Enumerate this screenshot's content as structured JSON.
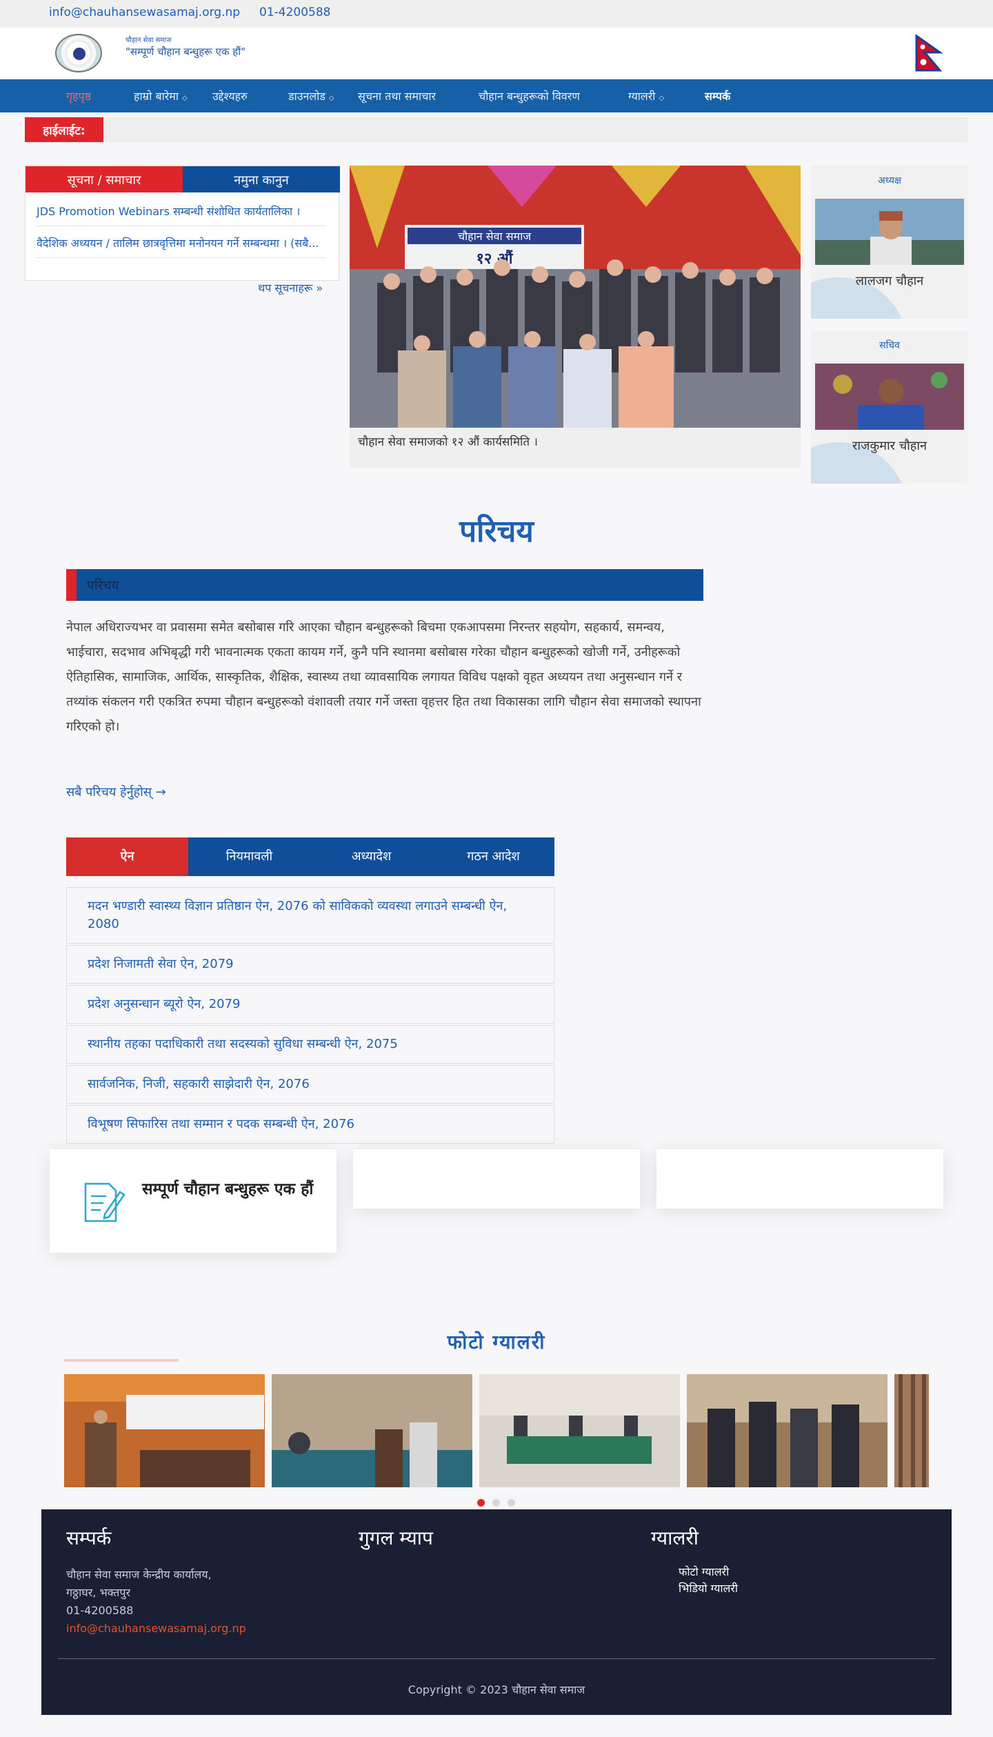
{
  "topbar": {
    "email": "info@chauhansewasamaj.org.np",
    "phone": "01-4200588"
  },
  "header": {
    "org_small": "चौहान सेवा समाज",
    "slogan": "\"सम्पूर्ण चौहान बन्धुहरू एक हौं\""
  },
  "nav": {
    "items": [
      {
        "label": "गृहपृष्ठ",
        "caret": false
      },
      {
        "label": "हाम्रो बारेमा",
        "caret": true
      },
      {
        "label": "उद्देश्यहरु",
        "caret": false
      },
      {
        "label": "डाउनलोड",
        "caret": true
      },
      {
        "label": "सूचना तथा समाचार",
        "caret": false
      },
      {
        "label": "चौहान बन्धुहरूको विवरण",
        "caret": false
      },
      {
        "label": "ग्यालरी",
        "caret": true
      },
      {
        "label": "सम्पर्क",
        "caret": false
      }
    ]
  },
  "highlight": {
    "label": "हाईलाईट:"
  },
  "news": {
    "tabs": [
      "सूचना / समाचार",
      "नमुना कानुन"
    ],
    "items": [
      "JDS Promotion Webinars सम्बन्धी संशोधित कार्यतालिका ।",
      "वैदेशिक अध्ययन / तालिम छात्रवृत्तिमा मनोनयन गर्ने सम्बन्धमा । (सबै..."
    ],
    "more": "थप सूचनाहरू »"
  },
  "hero": {
    "banner_org": "चौहान सेवा समाज",
    "banner_sub": "१२ औं",
    "caption": "चौहान सेवा समाजको १२ औं कार्यसमिति ।"
  },
  "profiles": [
    {
      "role": "अध्यक्ष",
      "name": "लालजग चौहान"
    },
    {
      "role": "सचिव",
      "name": "राजकुमार चौहान"
    }
  ],
  "intro": {
    "title": "परिचय",
    "bar_label": "परिचय",
    "text": "नेपाल अधिराज्यभर वा प्रवासमा समेत बसोबास गरि आएका चौहान बन्धुहरूको बिचमा एकआपसमा निरन्तर सहयोग, सहकार्य, समन्वय, भाईचारा, सदभाव अभिबृद्धी गरी भावनात्मक एकता कायम गर्ने, कुनै पनि स्थानमा बसोबास गरेका चौहान बन्धुहरूको खोजी गर्ने, उनीहरूको ऐतिहासिक, सामाजिक, आर्थिक, सास्कृतिक, शैक्षिक, स्वास्थ्य तथा व्यावसायिक लगायत विविध पक्षको वृहत अध्ययन तथा अनुसन्धान गर्ने र तथ्यांक संकलन गरी एकत्रित रुपमा चौहान बन्धुहरूको वंशावली तयार गर्ने जस्ता वृहत्तर हित तथा विकासका लागि चौहान सेवा समाजको स्थापना गरिएको हो।",
    "more": "सबै परिचय हेर्नुहोस्  →"
  },
  "law": {
    "tabs": [
      "ऐन",
      "नियमावली",
      "अध्यादेश",
      "गठन आदेश"
    ],
    "items": [
      "मदन भण्डारी स्वास्थ्य विज्ञान प्रतिष्ठान ऐन, 2076 को साविकको व्यवस्था लगाउने सम्बन्धी ऐन, 2080",
      "प्रदेश निजामती सेवा ऐन, 2079",
      "प्रदेश अनुसन्धान ब्यूरो ऐन, 2079",
      "स्थानीय तहका पदाधिकारी तथा सदस्यको सुविधा सम्बन्धी ऐन, 2075",
      "सार्वजनिक, निजी, सहकारी साझेदारी ऐन, 2076",
      "विभूषण सिफारिस तथा सम्मान र पदक सम्बन्धी ऐन, 2076"
    ]
  },
  "feature": {
    "card1": "सम्पूर्ण चौहान बन्धुहरू एक हौं"
  },
  "gallery": {
    "title": "फोटो ग्यालरी"
  },
  "footer": {
    "contact_title": "सम्पर्क",
    "map_title": "गुगल म्याप",
    "gallery_title": "ग्यालरी",
    "address1": "चौहान सेवा समाज केन्द्रीय कार्यालय,",
    "address2": "गठ्ठाघर, भक्तपुर",
    "phone": "01-4200588",
    "email": "info@chauhansewasamaj.org.np",
    "link1": "फोटो ग्यालरी",
    "link2": "भिडियो ग्यालरी",
    "copyright": "Copyright © 2023 चौहान सेवा समाज"
  },
  "colors": {
    "primary": "#1560a6",
    "accent": "#e0252a",
    "footer": "#1b1f33"
  }
}
